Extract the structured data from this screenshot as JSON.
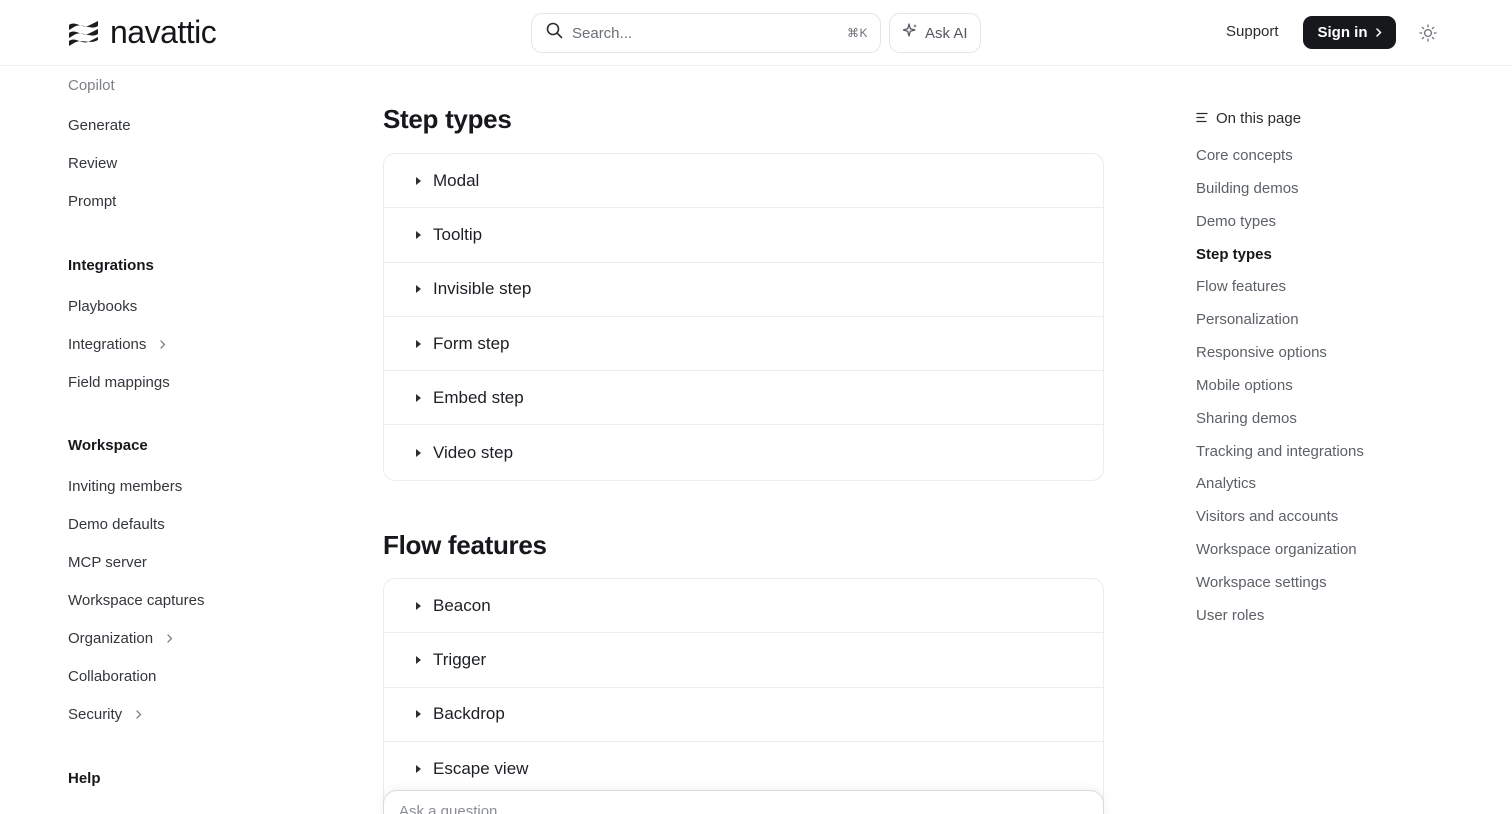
{
  "header": {
    "logo_text": "navattic",
    "search_placeholder": "Search...",
    "search_shortcut": "⌘K",
    "ask_ai_label": "Ask AI",
    "support_label": "Support",
    "signin_label": "Sign in",
    "icons": [
      "navattic-logo-icon",
      "search-icon",
      "sparkle-icon",
      "chevron-right-icon",
      "sun-icon"
    ]
  },
  "sidebar": {
    "copilot_label": "Copilot",
    "copilot_items": [
      "Generate",
      "Review",
      "Prompt"
    ],
    "integrations_heading": "Integrations",
    "integrations_items": [
      "Playbooks",
      "Integrations",
      "Field mappings"
    ],
    "workspace_heading": "Workspace",
    "workspace_items": [
      "Inviting members",
      "Demo defaults",
      "MCP server",
      "Workspace captures",
      "Organization",
      "Collaboration",
      "Security"
    ],
    "help_heading": "Help"
  },
  "main": {
    "step_types": {
      "title": "Step types",
      "items": [
        "Modal",
        "Tooltip",
        "Invisible step",
        "Form step",
        "Embed step",
        "Video step"
      ]
    },
    "flow_features": {
      "title": "Flow features",
      "items": [
        "Beacon",
        "Trigger",
        "Backdrop",
        "Escape view"
      ]
    },
    "ask_placeholder": "Ask a question..."
  },
  "toc": {
    "heading": "On this page",
    "items": [
      "Core concepts",
      "Building demos",
      "Demo types",
      "Step types",
      "Flow features",
      "Personalization",
      "Responsive options",
      "Mobile options",
      "Sharing demos",
      "Tracking and integrations",
      "Analytics",
      "Visitors and accounts",
      "Workspace organization",
      "Workspace settings",
      "User roles"
    ],
    "active_item": "Step types"
  },
  "colors": {
    "primary_text": "#16181b",
    "signin_bg": "#16181b",
    "border": "#ebecef",
    "muted_text": "#5c6167"
  }
}
